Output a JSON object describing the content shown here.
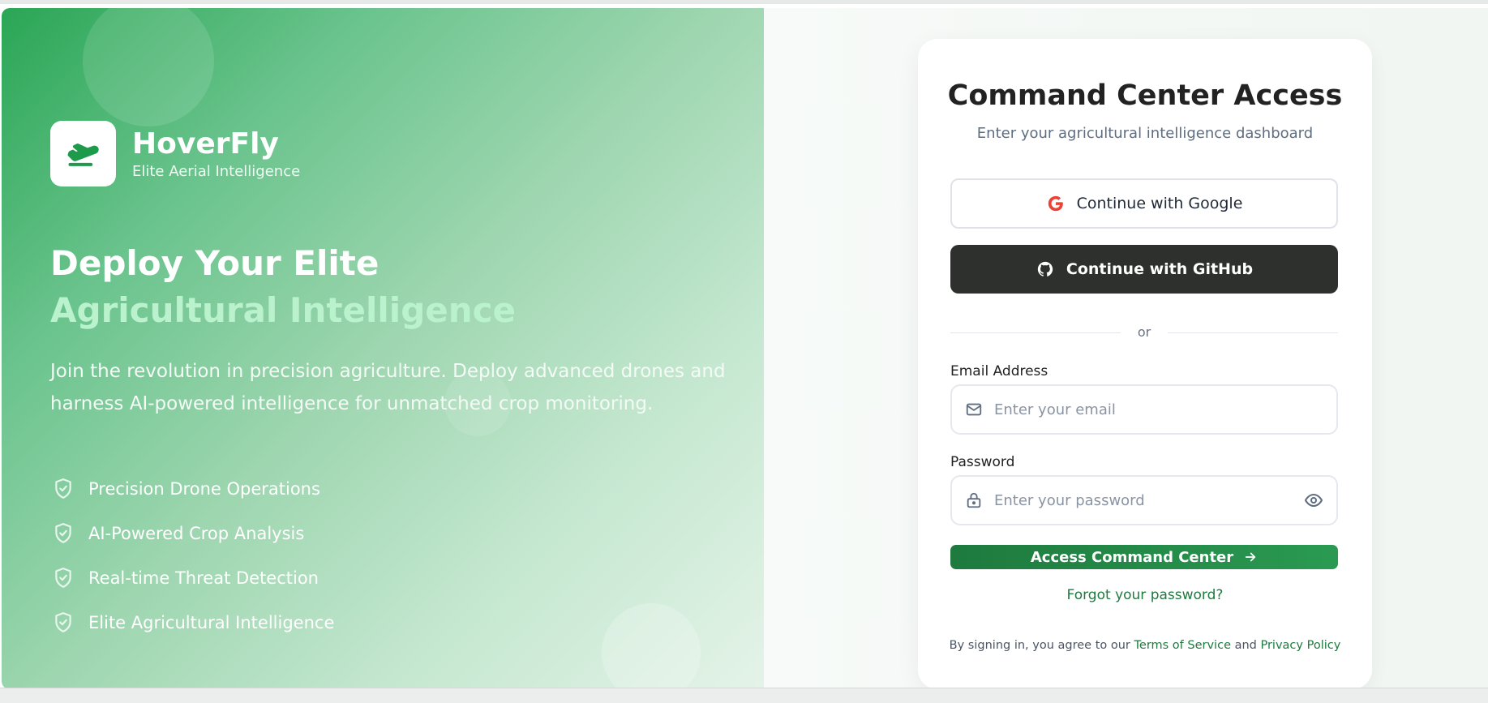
{
  "brand": {
    "name": "HoverFly",
    "tagline": "Elite Aerial Intelligence",
    "logo_icon": "plane-takeoff-icon",
    "accent": "#2aa655"
  },
  "hero": {
    "headline_line1": "Deploy Your Elite",
    "headline_line2": "Agricultural Intelligence",
    "description": "Join the revolution in precision agriculture. Deploy advanced drones and harness AI-powered intelligence for unmatched crop monitoring.",
    "features": [
      {
        "label": "Precision Drone Operations",
        "icon": "shield-check-icon"
      },
      {
        "label": "AI-Powered Crop Analysis",
        "icon": "shield-check-icon"
      },
      {
        "label": "Real-time Threat Detection",
        "icon": "shield-check-icon"
      },
      {
        "label": "Elite Agricultural Intelligence",
        "icon": "shield-check-icon"
      }
    ]
  },
  "card": {
    "title": "Command Center Access",
    "subtitle": "Enter your agricultural intelligence dashboard",
    "google_label": "Continue with Google",
    "github_label": "Continue with GitHub",
    "divider_text": "or",
    "email_label": "Email Address",
    "email_placeholder": "Enter your email",
    "email_value": "",
    "password_label": "Password",
    "password_placeholder": "Enter your password",
    "password_value": "",
    "submit_label": "Access Command Center",
    "forgot_label": "Forgot your password?",
    "legal_prefix": "By signing in, you agree to our",
    "terms_label": "Terms of Service",
    "legal_and": "and",
    "privacy_label": "Privacy Policy"
  },
  "colors": {
    "primary_green": "#1e7a3e",
    "github_dark": "#2e302e",
    "google_red": "#ea4335"
  }
}
